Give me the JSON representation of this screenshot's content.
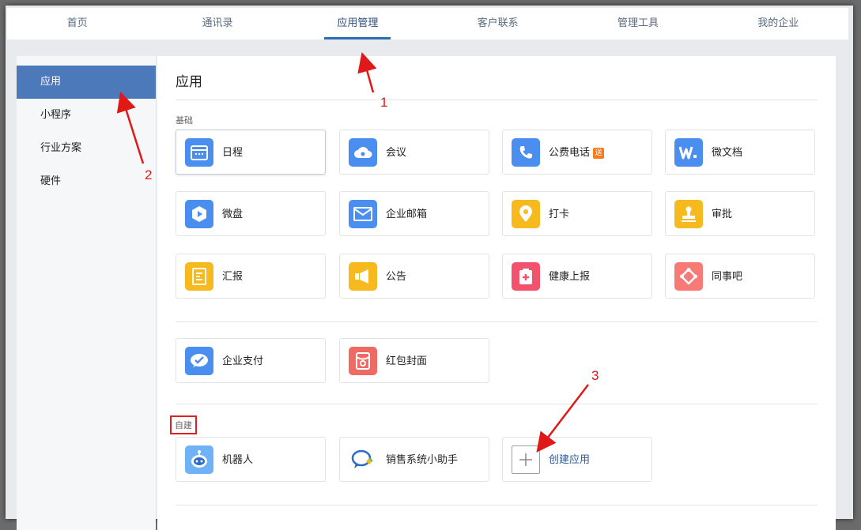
{
  "topnav": {
    "tabs": [
      {
        "label": "首页",
        "active": false
      },
      {
        "label": "通讯录",
        "active": false
      },
      {
        "label": "应用管理",
        "active": true
      },
      {
        "label": "客户联系",
        "active": false
      },
      {
        "label": "管理工具",
        "active": false
      },
      {
        "label": "我的企业",
        "active": false
      }
    ]
  },
  "sidebar": {
    "items": [
      {
        "label": "应用",
        "active": true
      },
      {
        "label": "小程序",
        "active": false
      },
      {
        "label": "行业方案",
        "active": false
      },
      {
        "label": "硬件",
        "active": false
      }
    ]
  },
  "main": {
    "title": "应用",
    "section_basic": "基础",
    "section_custom": "自建",
    "apps_basic": [
      {
        "label": "日程",
        "icon": "calendar-icon",
        "color": "#4a8ff0"
      },
      {
        "label": "会议",
        "icon": "cloud-icon",
        "color": "#4a8ff0"
      },
      {
        "label": "公费电话",
        "icon": "phone-icon",
        "color": "#4a8ff0",
        "badge": "送"
      },
      {
        "label": "微文档",
        "icon": "document-w-icon",
        "color": "#4a8ff0"
      },
      {
        "label": "微盘",
        "icon": "drive-icon",
        "color": "#4a8ff0"
      },
      {
        "label": "企业邮箱",
        "icon": "mail-icon",
        "color": "#4a8ff0"
      },
      {
        "label": "打卡",
        "icon": "location-pin-icon",
        "color": "#f6b91e"
      },
      {
        "label": "审批",
        "icon": "stamp-icon",
        "color": "#f6b91e"
      },
      {
        "label": "汇报",
        "icon": "report-icon",
        "color": "#f6b91e"
      },
      {
        "label": "公告",
        "icon": "megaphone-icon",
        "color": "#f6b91e"
      },
      {
        "label": "健康上报",
        "icon": "health-icon",
        "color": "#f2526b"
      },
      {
        "label": "同事吧",
        "icon": "colleague-icon",
        "color": "#f77a76"
      }
    ],
    "apps_pay": [
      {
        "label": "企业支付",
        "icon": "pay-icon",
        "color": "#4a8ff0"
      },
      {
        "label": "红包封面",
        "icon": "red-packet-icon",
        "color": "#ee6a63"
      }
    ],
    "apps_custom": [
      {
        "label": "机器人",
        "icon": "robot-icon",
        "color": "#4a8ff0"
      },
      {
        "label": "销售系统小助手",
        "icon": "chat-bubble-icon",
        "color": "#4a8ff0"
      },
      {
        "label": "创建应用",
        "icon": "plus-icon",
        "color": "#888888"
      }
    ]
  },
  "annotations": {
    "n1": "1",
    "n2": "2",
    "n3": "3",
    "color": "#e01818"
  }
}
